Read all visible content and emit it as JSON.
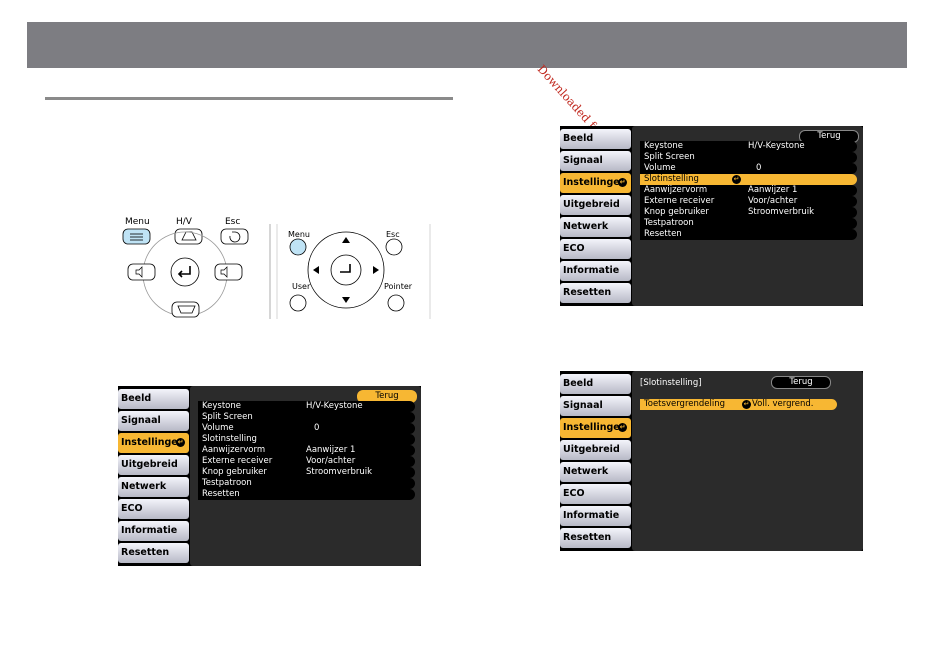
{
  "watermark": "Downloaded from www.vandenborre.be",
  "remote_labels": {
    "menu": "Menu",
    "hv": "H/V",
    "esc": "Esc",
    "menu2": "Menu",
    "esc2": "Esc",
    "user": "User",
    "pointer": "Pointer"
  },
  "tabs": [
    "Beeld",
    "Signaal",
    "Instellingen",
    "Uitgebreid",
    "Netwerk",
    "ECO",
    "Informatie",
    "Resetten"
  ],
  "back_label": "Terug",
  "rows": [
    {
      "label": "Keystone",
      "value": "H/V-Keystone"
    },
    {
      "label": "Split Screen",
      "value": ""
    },
    {
      "label": "Volume",
      "value": "0"
    },
    {
      "label": "Slotinstelling",
      "value": ""
    },
    {
      "label": "Aanwijzervorm",
      "value": "Aanwijzer 1"
    },
    {
      "label": "Externe receiver",
      "value": "Voor/achter"
    },
    {
      "label": "Knop gebruiker",
      "value": "Stroomverbruik"
    },
    {
      "label": "Testpatroon",
      "value": ""
    },
    {
      "label": "Resetten",
      "value": ""
    }
  ],
  "submenu": {
    "title": "[Slotinstelling]",
    "back": "Terug",
    "item_label": "Toetsvergrendeling",
    "item_value": "Voll. vergrend."
  },
  "colors": {
    "highlight": "#f7b733",
    "header": "#7d7d82",
    "watermark": "#c0281e"
  }
}
